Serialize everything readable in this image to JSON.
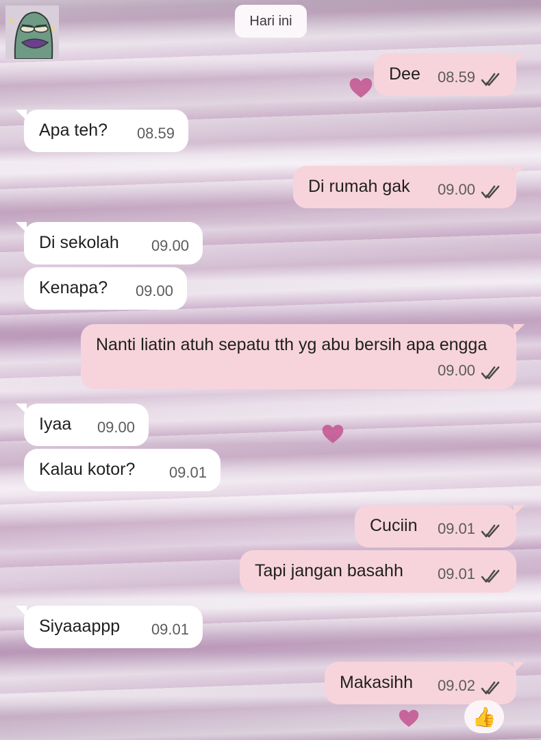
{
  "date_chip": "Hari ini",
  "messages": [
    {
      "dir": "out",
      "text": "Dee",
      "time": "08.59",
      "status": "read"
    },
    {
      "dir": "in",
      "text": "Apa teh?",
      "time": "08.59"
    },
    {
      "dir": "out",
      "text": "Di rumah gak",
      "time": "09.00",
      "status": "read"
    },
    {
      "dir": "in",
      "text": "Di sekolah",
      "time": "09.00"
    },
    {
      "dir": "in",
      "text": "Kenapa?",
      "time": "09.00"
    },
    {
      "dir": "out",
      "text": "Nanti liatin atuh sepatu tth yg abu bersih apa engga",
      "time": "09.00",
      "status": "read"
    },
    {
      "dir": "in",
      "text": "Iyaa",
      "time": "09.00"
    },
    {
      "dir": "in",
      "text": "Kalau kotor?",
      "time": "09.01"
    },
    {
      "dir": "out",
      "text": "Cuciin",
      "time": "09.01",
      "status": "read"
    },
    {
      "dir": "out",
      "text": "Tapi jangan basahh",
      "time": "09.01",
      "status": "read"
    },
    {
      "dir": "in",
      "text": "Siyaaappp",
      "time": "09.01"
    },
    {
      "dir": "out",
      "text": "Makasihh",
      "time": "09.02",
      "status": "read",
      "reaction": "👍"
    }
  ],
  "colors": {
    "incoming": "#ffffff",
    "outgoing": "#f7d3dc",
    "ticks": "#4a4a4a",
    "heart": "#c2538f"
  },
  "icons": {
    "ticks": "double-check-icon",
    "reaction": "thumbs-up-emoji",
    "avatar": "cartoon-avatar"
  }
}
